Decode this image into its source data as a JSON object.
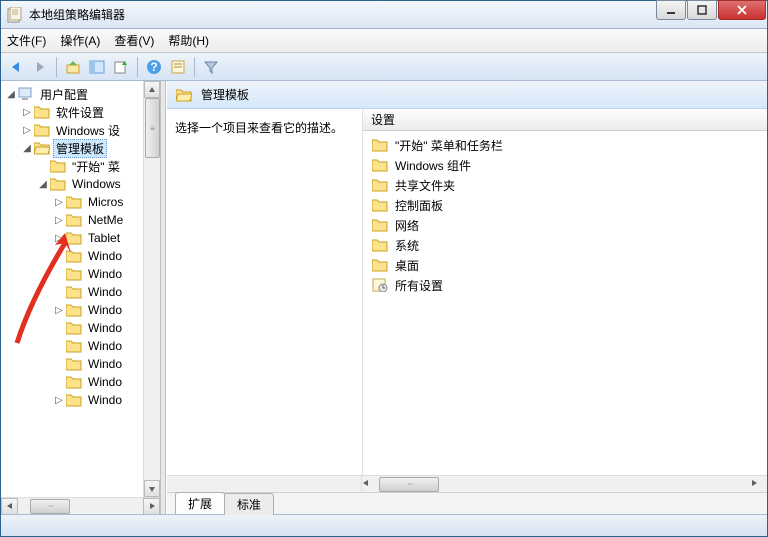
{
  "window": {
    "title": "本地组策略编辑器"
  },
  "menubar": {
    "file": "文件(F)",
    "action": "操作(A)",
    "view": "查看(V)",
    "help": "帮助(H)"
  },
  "tree": {
    "root": "用户配置",
    "n1": "软件设置",
    "n2": "Windows 设",
    "n3": "管理模板",
    "n3a": "\"开始\" 菜",
    "n3b": "Windows",
    "n3b1": "Micros",
    "n3b2": "NetMe",
    "n3b3": "Tablet",
    "n3b4": "Windo",
    "n3b5": "Windo",
    "n3b6": "Windo",
    "n3b7": "Windo",
    "n3b8": "Windo",
    "n3b9": "Windo",
    "n3b10": "Windo",
    "n3b11": "Windo",
    "n3b12": "Windo"
  },
  "details": {
    "header": "管理模板",
    "prompt": "选择一个项目来查看它的描述。",
    "col_setting": "设置",
    "items": {
      "i0": "\"开始\" 菜单和任务栏",
      "i1": "Windows 组件",
      "i2": "共享文件夹",
      "i3": "控制面板",
      "i4": "网络",
      "i5": "系统",
      "i6": "桌面",
      "i7": "所有设置"
    }
  },
  "tabs": {
    "extended": "扩展",
    "standard": "标准"
  }
}
